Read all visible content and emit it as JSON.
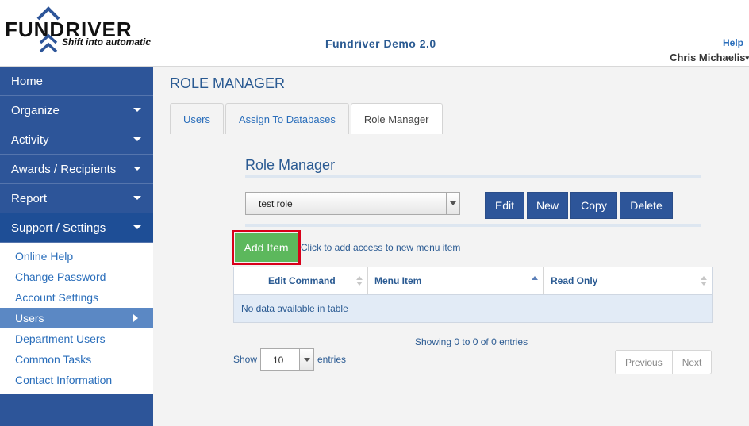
{
  "header": {
    "logo_text": "FUNDRIVER",
    "logo_tagline": "Shift into automatic",
    "app_title": "Fundriver Demo 2.0",
    "help_label": "Help",
    "user_name": "Chris Michaelis"
  },
  "sidebar": {
    "items": [
      {
        "label": "Home",
        "has_caret": false
      },
      {
        "label": "Organize",
        "has_caret": true
      },
      {
        "label": "Activity",
        "has_caret": true
      },
      {
        "label": "Awards / Recipients",
        "has_caret": true
      },
      {
        "label": "Report",
        "has_caret": true
      },
      {
        "label": "Support / Settings",
        "has_caret": true
      }
    ],
    "subitems": [
      {
        "label": "Online Help"
      },
      {
        "label": "Change Password"
      },
      {
        "label": "Account Settings"
      },
      {
        "label": "Users"
      },
      {
        "label": "Department Users"
      },
      {
        "label": "Common Tasks"
      },
      {
        "label": "Contact Information"
      }
    ]
  },
  "main": {
    "page_title": "ROLE MANAGER",
    "tabs": [
      {
        "label": "Users"
      },
      {
        "label": "Assign To Databases"
      },
      {
        "label": "Role Manager"
      }
    ],
    "section_title": "Role Manager",
    "role_select_value": "test role",
    "buttons": {
      "edit": "Edit",
      "new": "New",
      "copy": "Copy",
      "delete": "Delete"
    },
    "add_item_label": "Add Item",
    "add_item_help": "Click to add access to new menu item",
    "table": {
      "columns": [
        "Edit Command",
        "Menu Item",
        "Read Only"
      ],
      "empty_message": "No data available in table"
    },
    "showing_text": "Showing 0 to 0 of 0 entries",
    "show_label": "Show",
    "page_length": "10",
    "entries_label": "entries",
    "pager": {
      "previous": "Previous",
      "next": "Next"
    }
  },
  "colors": {
    "sidebar_bg": "#2d5599",
    "accent_blue": "#2a5a92",
    "link_blue": "#2a6ebb",
    "add_green": "#5cb85c",
    "highlight_red": "#d8001a"
  }
}
